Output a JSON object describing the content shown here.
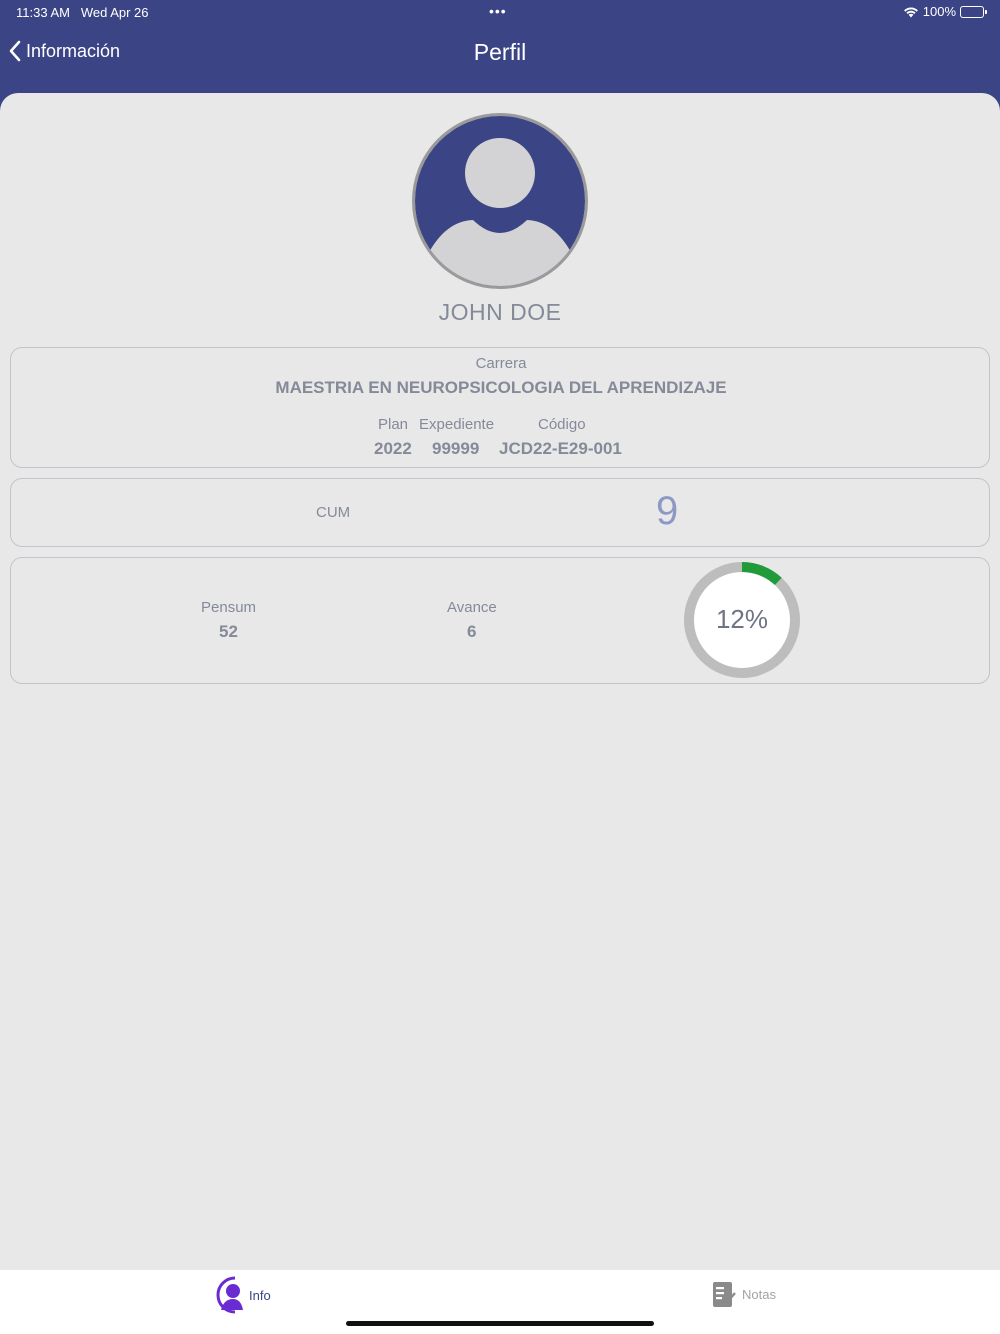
{
  "status": {
    "time": "11:33 AM",
    "date": "Wed Apr 26",
    "dots": "•••",
    "battery": "100%"
  },
  "nav": {
    "back_label": "Información",
    "title": "Perfil"
  },
  "profile": {
    "name": "JOHN DOE"
  },
  "career_card": {
    "career_label": "Carrera",
    "career_value": "MAESTRIA EN NEUROPSICOLOGIA DEL APRENDIZAJE",
    "plan_label": "Plan",
    "plan_value": "2022",
    "expediente_label": "Expediente",
    "expediente_value": "99999",
    "codigo_label": "Código",
    "codigo_value": "JCD22-E29-001"
  },
  "cum_card": {
    "label": "CUM",
    "value": "9"
  },
  "progress_card": {
    "pensum_label": "Pensum",
    "pensum_value": "52",
    "avance_label": "Avance",
    "avance_value": "6",
    "percent_text": "12%",
    "percent_value": 12
  },
  "tabs": [
    {
      "label": "Info",
      "icon": "profile-icon",
      "active": true
    },
    {
      "label": "Notas",
      "icon": "notes-icon",
      "active": false
    }
  ],
  "colors": {
    "header": "#3b4585",
    "content_bg": "#e8e8e8",
    "text_muted": "#858a99",
    "accent_purple": "#6a2bd1",
    "progress_green": "#1f9b3a",
    "ring_gray": "#bdbdbd"
  }
}
